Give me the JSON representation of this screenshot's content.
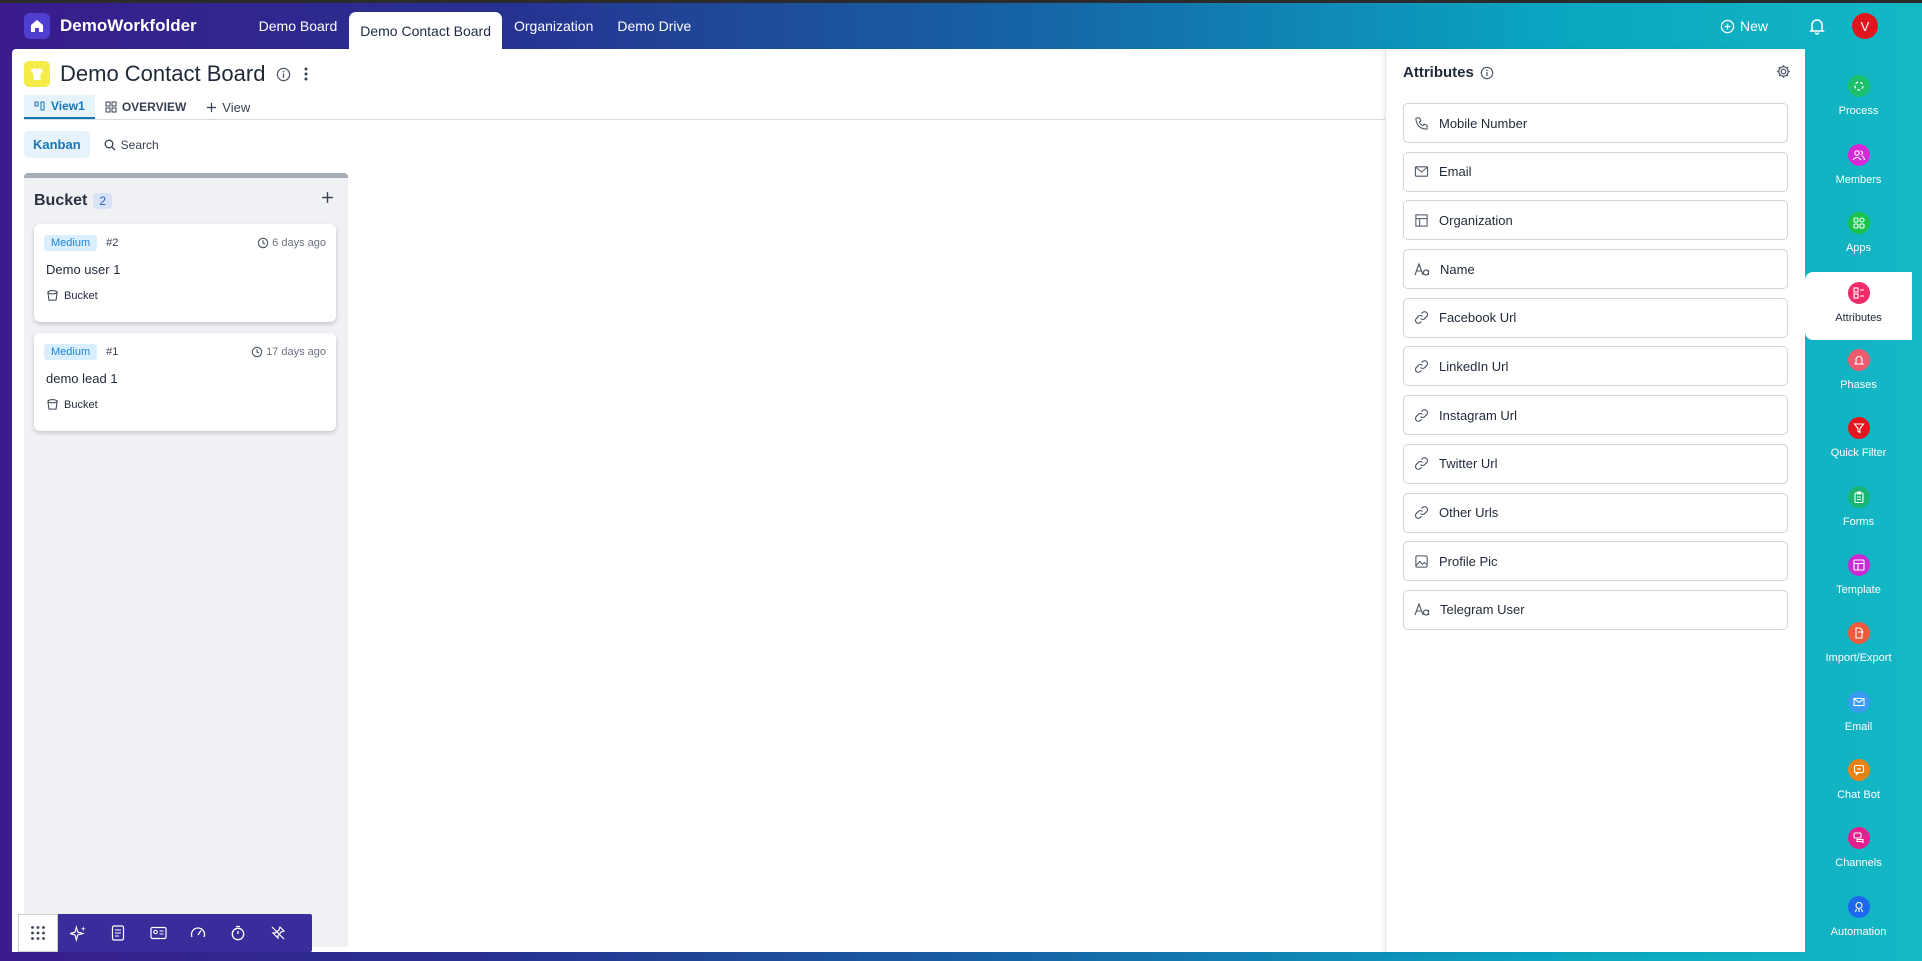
{
  "app": {
    "name": "DemoWorkfolder",
    "tabs": [
      {
        "label": "Demo Board"
      },
      {
        "label": "Demo Contact Board"
      },
      {
        "label": "Organization"
      },
      {
        "label": "Demo Drive"
      }
    ],
    "active_tab": "Demo Contact Board",
    "new_label": "New",
    "avatar_initial": "V"
  },
  "board": {
    "title": "Demo Contact Board",
    "views": [
      {
        "label": "View1"
      },
      {
        "label": "OVERVIEW"
      },
      {
        "label": "View"
      }
    ],
    "kanban_label": "Kanban",
    "search_label": "Search"
  },
  "column": {
    "title": "Bucket",
    "count": "2",
    "cards": [
      {
        "priority": "Medium",
        "number": "#2",
        "time": "6 days ago",
        "name": "Demo user 1",
        "bucket": "Bucket"
      },
      {
        "priority": "Medium",
        "number": "#1",
        "time": "17 days ago",
        "name": "demo lead 1",
        "bucket": "Bucket"
      }
    ]
  },
  "attributes": {
    "title": "Attributes",
    "items": [
      {
        "label": "Mobile Number",
        "icon": "phone-icon"
      },
      {
        "label": "Email",
        "icon": "mail-icon"
      },
      {
        "label": "Organization",
        "icon": "table-icon"
      },
      {
        "label": "Name",
        "icon": "text-icon"
      },
      {
        "label": "Facebook Url",
        "icon": "link-icon"
      },
      {
        "label": "LinkedIn Url",
        "icon": "link-icon"
      },
      {
        "label": "Instagram Url",
        "icon": "link-icon"
      },
      {
        "label": "Twitter Url",
        "icon": "link-icon"
      },
      {
        "label": "Other Urls",
        "icon": "link-icon"
      },
      {
        "label": "Profile Pic",
        "icon": "image-icon"
      },
      {
        "label": "Telegram User",
        "icon": "text-icon"
      }
    ]
  },
  "sidebar": {
    "items": [
      {
        "label": "Process",
        "color": "#1bc06a"
      },
      {
        "label": "Members",
        "color": "#d62ad9"
      },
      {
        "label": "Apps",
        "color": "#1bc24a"
      },
      {
        "label": "Attributes",
        "color": "#ef2d6a"
      },
      {
        "label": "Phases",
        "color": "#ef5b6e"
      },
      {
        "label": "Quick Filter",
        "color": "#e3151f"
      },
      {
        "label": "Forms",
        "color": "#18b574"
      },
      {
        "label": "Template",
        "color": "#c82bd4"
      },
      {
        "label": "Import/Export",
        "color": "#ef5b3c"
      },
      {
        "label": "Email",
        "color": "#3a9bf0"
      },
      {
        "label": "Chat Bot",
        "color": "#e98216"
      },
      {
        "label": "Channels",
        "color": "#e61f8e"
      },
      {
        "label": "Automation",
        "color": "#1f67ee"
      }
    ],
    "active": "Attributes"
  }
}
